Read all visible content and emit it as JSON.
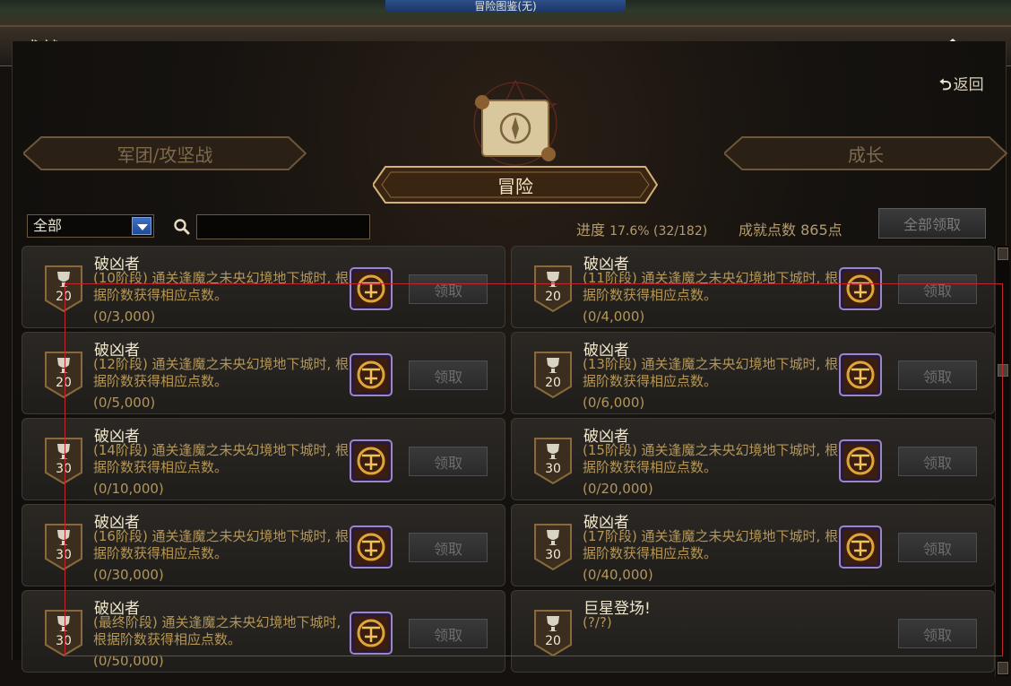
{
  "window": {
    "top_title": "冒险图鉴(无)",
    "title": "成就",
    "back_label": "返回"
  },
  "nav": {
    "back_label": "返回"
  },
  "categories": {
    "left": "军团/攻坚战",
    "center": "冒险",
    "right": "成长"
  },
  "filter": {
    "selected": "全部",
    "search_value": ""
  },
  "summary": {
    "progress_label": "进度",
    "progress_value": "17.6% (32/182)",
    "points_label": "成就点数",
    "points_value": "865点",
    "claim_all_label": "全部领取"
  },
  "achievements": [
    {
      "points": "20",
      "name": "破凶者",
      "desc": "(10阶段) 通关逢魔之未央幻境地下城时, 根据阶数获得相应点数。",
      "progress": "(0/3,000)",
      "has_reward": true,
      "claim_label": "领取"
    },
    {
      "points": "20",
      "name": "破凶者",
      "desc": "(11阶段) 通关逢魔之未央幻境地下城时, 根据阶数获得相应点数。",
      "progress": "(0/4,000)",
      "has_reward": true,
      "claim_label": "领取"
    },
    {
      "points": "20",
      "name": "破凶者",
      "desc": "(12阶段) 通关逢魔之未央幻境地下城时, 根据阶数获得相应点数。",
      "progress": "(0/5,000)",
      "has_reward": true,
      "claim_label": "领取"
    },
    {
      "points": "20",
      "name": "破凶者",
      "desc": "(13阶段) 通关逢魔之未央幻境地下城时, 根据阶数获得相应点数。",
      "progress": "(0/6,000)",
      "has_reward": true,
      "claim_label": "领取"
    },
    {
      "points": "30",
      "name": "破凶者",
      "desc": "(14阶段) 通关逢魔之未央幻境地下城时, 根据阶数获得相应点数。",
      "progress": "(0/10,000)",
      "has_reward": true,
      "claim_label": "领取"
    },
    {
      "points": "30",
      "name": "破凶者",
      "desc": "(15阶段) 通关逢魔之未央幻境地下城时, 根据阶数获得相应点数。",
      "progress": "(0/20,000)",
      "has_reward": true,
      "claim_label": "领取"
    },
    {
      "points": "30",
      "name": "破凶者",
      "desc": "(16阶段) 通关逢魔之未央幻境地下城时, 根据阶数获得相应点数。",
      "progress": "(0/30,000)",
      "has_reward": true,
      "claim_label": "领取"
    },
    {
      "points": "30",
      "name": "破凶者",
      "desc": "(17阶段) 通关逢魔之未央幻境地下城时, 根据阶数获得相应点数。",
      "progress": "(0/40,000)",
      "has_reward": true,
      "claim_label": "领取"
    },
    {
      "points": "30",
      "name": "破凶者",
      "desc": "(最终阶段) 通关逢魔之未央幻境地下城时, 根据阶数获得相应点数。",
      "progress": "(0/50,000)",
      "has_reward": true,
      "claim_label": "领取"
    },
    {
      "points": "20",
      "name": "巨星登场!",
      "desc": "(?/?)",
      "progress": "",
      "has_reward": false,
      "claim_label": "领取"
    }
  ],
  "colors": {
    "accent": "#c9b48a",
    "panel": "#14110e",
    "selection": "#c0272d"
  },
  "icons": {
    "home": "home-icon",
    "back": "return-arrow-icon",
    "search": "search-icon",
    "trophy": "trophy-icon",
    "reward": "emblem-icon"
  }
}
